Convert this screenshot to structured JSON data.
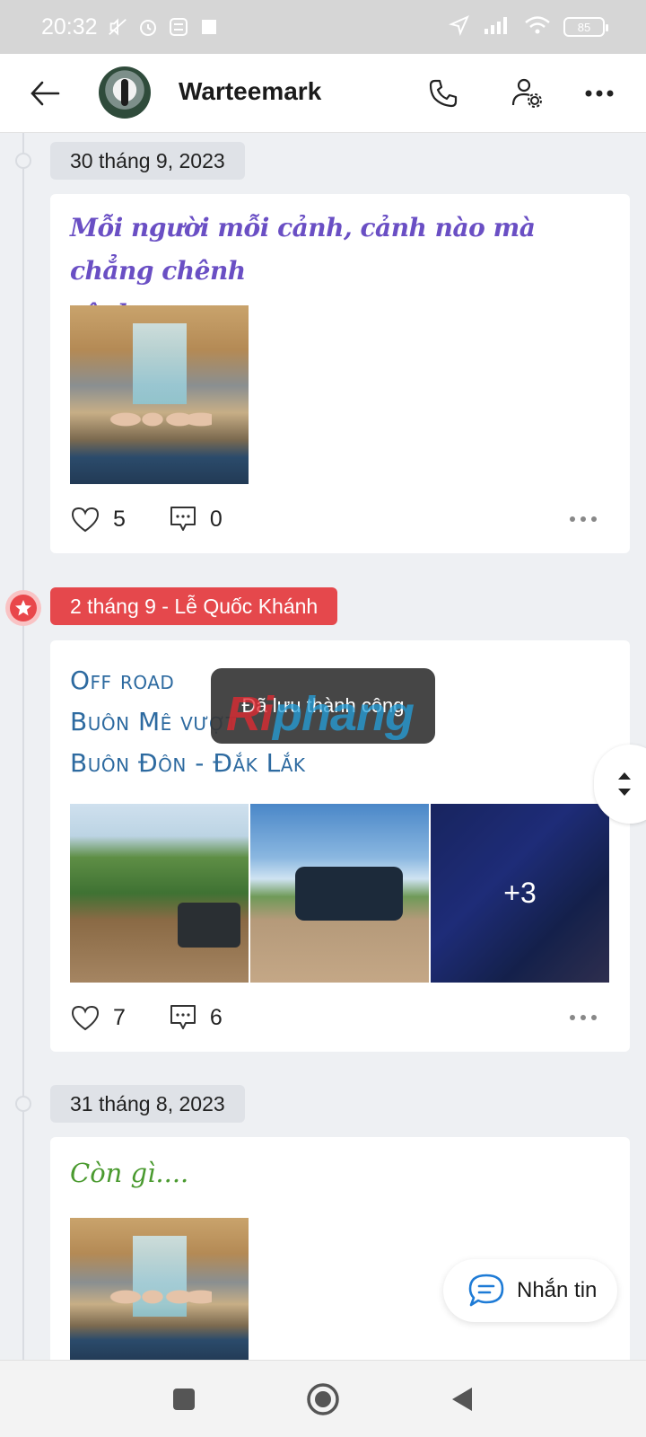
{
  "status_bar": {
    "time": "20:32",
    "battery": "85"
  },
  "header": {
    "contact_name": "Warteemark"
  },
  "posts": [
    {
      "date": "30 tháng 9, 2023",
      "text_lines": [
        "Mỗi người mỗi cảnh, cảnh nào mà chẳng chênh",
        "vênh,.."
      ],
      "likes": "5",
      "comments": "0"
    },
    {
      "date": "2 tháng 9 - Lễ Quốc Khánh",
      "text_lines": [
        "Off road",
        "Buôn Mê vượt",
        "Buôn Đôn - Đắk Lắk"
      ],
      "more_photos": "+3",
      "likes": "7",
      "comments": "6"
    },
    {
      "date": "31 tháng 8, 2023",
      "text_lines": [
        "Còn gì...."
      ]
    }
  ],
  "toast": {
    "message": "Đã lưu thành công"
  },
  "watermark": {
    "part1": "Ri",
    "part2": "phang"
  },
  "message_button": {
    "label": "Nhắn tin"
  },
  "colors": {
    "accent_red": "#e5484c",
    "link_blue": "#1e7bd6",
    "script_purple": "#6a4fc4"
  },
  "icons": [
    "back-arrow-icon",
    "phone-icon",
    "user-settings-icon",
    "more-icon",
    "heart-icon",
    "comment-icon",
    "star-icon",
    "chat-icon"
  ]
}
